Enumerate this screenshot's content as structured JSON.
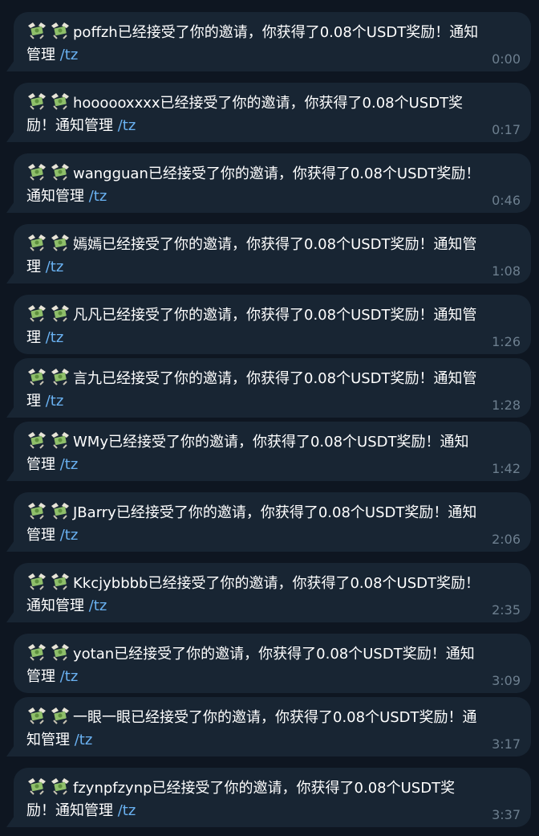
{
  "messages": [
    {
      "pre": "poffzh已经接受了你的邀请，你获得了0.08个USDT奖励！通知管理",
      "cmd": "/tz",
      "time": "0:00"
    },
    {
      "pre": "hoooooxxxx已经接受了你的邀请，你获得了0.08个USDT奖励！通知管理",
      "cmd": "/tz",
      "time": "0:17"
    },
    {
      "pre": "wangguan已经接受了你的邀请，你获得了0.08个USDT奖励！通知管理",
      "cmd": "/tz",
      "time": "0:46"
    },
    {
      "pre": "嫣嫣已经接受了你的邀请，你获得了0.08个USDT奖励！通知管理",
      "cmd": "/tz",
      "time": "1:08"
    },
    {
      "pre": "凡凡已经接受了你的邀请，你获得了0.08个USDT奖励！通知管理",
      "cmd": "/tz",
      "time": "1:26"
    },
    {
      "pre": "言九已经接受了你的邀请，你获得了0.08个USDT奖励！通知管理",
      "cmd": "/tz",
      "time": "1:28"
    },
    {
      "pre": "WMy已经接受了你的邀请，你获得了0.08个USDT奖励！通知管理",
      "cmd": "/tz",
      "time": "1:42"
    },
    {
      "pre": "JBarry已经接受了你的邀请，你获得了0.08个USDT奖励！通知管理",
      "cmd": "/tz",
      "time": "2:06"
    },
    {
      "pre": "Kkcjybbbb已经接受了你的邀请，你获得了0.08个USDT奖励！通知管理",
      "cmd": "/tz",
      "time": "2:35"
    },
    {
      "pre": "yotan已经接受了你的邀请，你获得了0.08个USDT奖励！通知管理",
      "cmd": "/tz",
      "time": "3:09"
    },
    {
      "pre": "一眼一眼已经接受了你的邀请，你获得了0.08个USDT奖励！通知管理",
      "cmd": "/tz",
      "time": "3:17"
    },
    {
      "pre": "fzynpfzynp已经接受了你的邀请，你获得了0.08个USDT奖励！通知管理",
      "cmd": "/tz",
      "time": "3:37"
    }
  ],
  "icons": {
    "emoji": "money-with-wings-icon"
  },
  "colors": {
    "background": "#0e1621",
    "bubble": "#182533",
    "link": "#6ab2f2",
    "time": "#6d7f8f"
  }
}
